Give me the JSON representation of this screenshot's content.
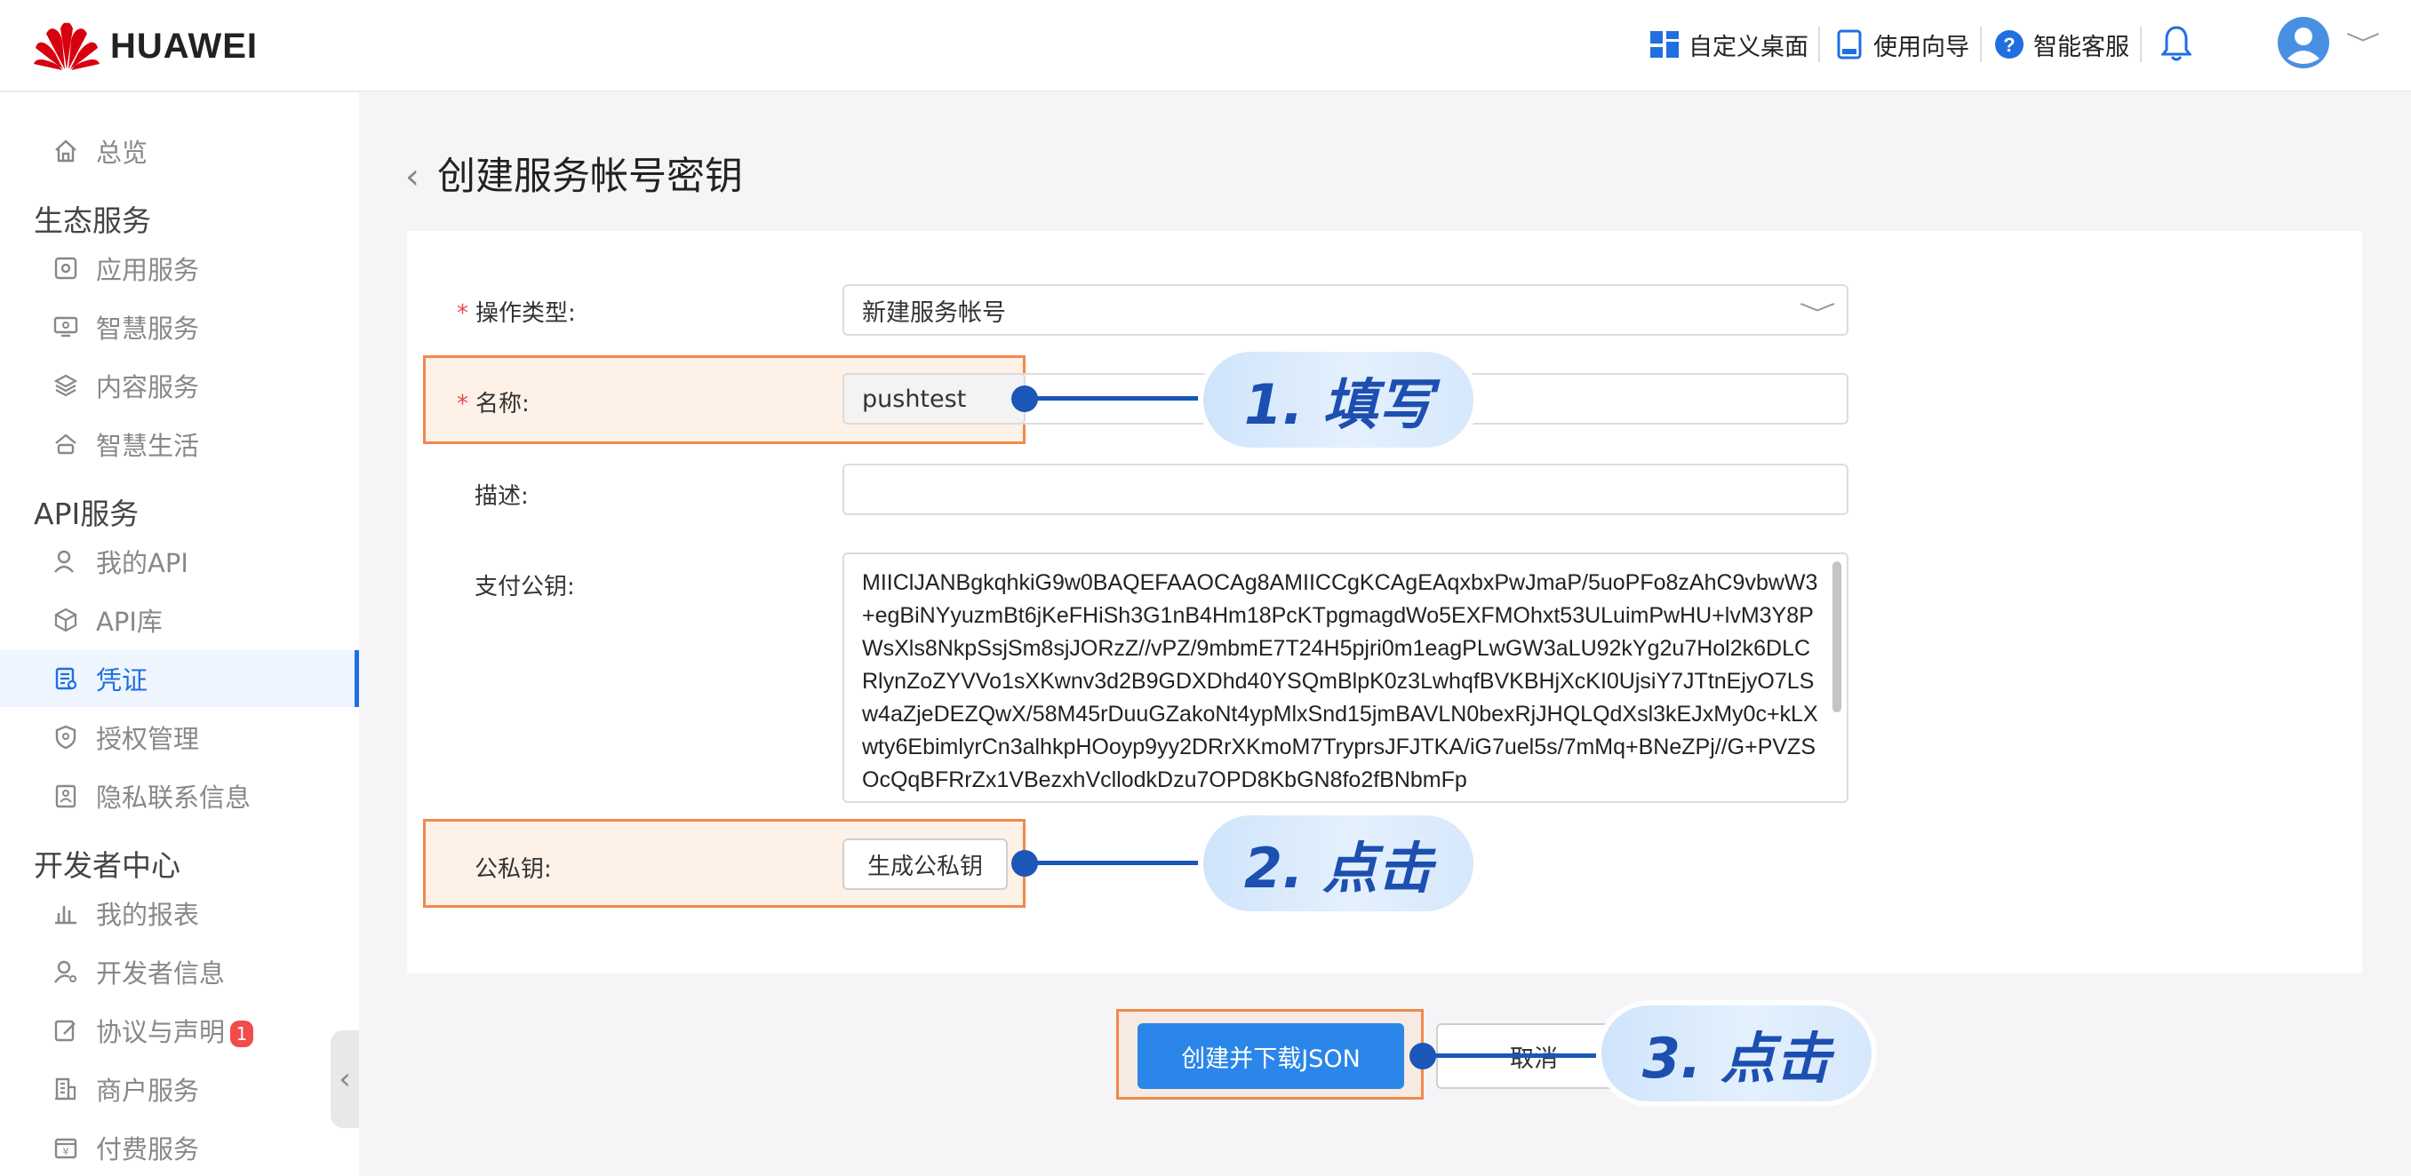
{
  "header": {
    "logo_text": "HUAWEI",
    "items": [
      {
        "label": "自定义桌面",
        "icon": "grid-icon"
      },
      {
        "label": "使用向导",
        "icon": "guide-icon"
      },
      {
        "label": "智能客服",
        "icon": "help-icon"
      }
    ],
    "bell_icon": "bell-icon",
    "avatar_icon": "avatar-icon"
  },
  "sidebar": {
    "overview": "总览",
    "groups": [
      {
        "title": "生态服务",
        "items": [
          "应用服务",
          "智慧服务",
          "内容服务",
          "智慧生活"
        ]
      },
      {
        "title": "API服务",
        "items": [
          "我的API",
          "API库",
          "凭证",
          "授权管理",
          "隐私联系信息"
        ]
      },
      {
        "title": "开发者中心",
        "items": [
          "我的报表",
          "开发者信息",
          "协议与声明",
          "商户服务",
          "付费服务"
        ]
      }
    ],
    "active_item": "凭证",
    "badge_count": "1",
    "colors": {
      "active": "#1f6fe0",
      "badge": "#f14b4b"
    }
  },
  "page": {
    "title": "创建服务帐号密钥"
  },
  "form": {
    "op_type_label": "操作类型:",
    "op_type_value": "新建服务帐号",
    "name_label": "名称:",
    "name_value": "pushtest",
    "desc_label": "描述:",
    "desc_value": "",
    "pay_key_label": "支付公钥:",
    "pay_key_value": "MIIClJANBgkqhkiG9w0BAQEFAAOCAg8AMIICCgKCAgEAqxbxPwJmaP/5uoPFo8zAhC9vbwW3+egBiNYyuzmBt6jKeFHiSh3G1nB4Hm18PcKTpgmagdWo5EXFMOhxt53ULuimPwHU+lvM3Y8PWsXls8NkpSsjSm8sjJORzZ//vPZ/9mbmE7T24H5pjri0m1eagPLwGW3aLU92kYg2u7Hol2k6DLCRlynZoZYVVo1sXKwnv3d2B9GDXDhd40YSQmBlpK0z3LwhqfBVKBHjXcKI0UjsiY7JTtnEjyO7LSw4aZjeDEZQwX/58M45rDuuGZakoNt4ypMlxSnd15jmBAVLN0bexRjJHQLQdXsl3kEJxMy0c+kLXwty6EbimlyrCn3alhkpHOoyp9yy2DRrXKmoM7TryprsJFJTKA/iG7uel5s/7mMq+BNeZPj//G+PVZSOcQqBFRrZx1VBezxhVcllodkDzu7OPD8KbGN8fo2fBNbmFp",
    "keypair_label": "公私钥:",
    "gen_button": "生成公私钥",
    "submit_button": "创建并下载JSON",
    "cancel_button": "取消"
  },
  "callouts": [
    {
      "label": "1. 填写"
    },
    {
      "label": "2. 点击"
    },
    {
      "label": "3. 点击"
    }
  ],
  "colors": {
    "primary": "#2a86e8",
    "highlight_border": "#f08a4b",
    "callout_text": "#1c4fb0"
  }
}
